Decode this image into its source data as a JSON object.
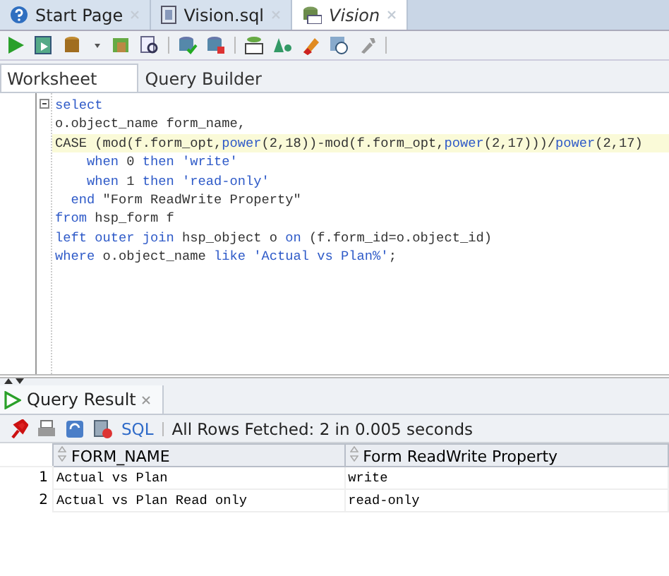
{
  "document_tabs": [
    {
      "label": "Start Page",
      "selected": false
    },
    {
      "label": "Vision.sql",
      "selected": false
    },
    {
      "label": "Vision",
      "selected": true
    }
  ],
  "editor_tabs": [
    {
      "label": "Worksheet",
      "selected": true
    },
    {
      "label": "Query Builder",
      "selected": false
    }
  ],
  "code_lines": [
    {
      "current": false,
      "tokens": [
        {
          "kind": "keyword",
          "text": "select"
        }
      ]
    },
    {
      "current": false,
      "tokens": [
        {
          "kind": "plain",
          "text": "o.object_name form_name,"
        }
      ]
    },
    {
      "current": true,
      "tokens": [
        {
          "kind": "plain",
          "text": "CASE (mod(f.form_opt,"
        },
        {
          "kind": "keyword",
          "text": "power"
        },
        {
          "kind": "plain",
          "text": "(2,18))-mod(f.form_opt,"
        },
        {
          "kind": "keyword",
          "text": "power"
        },
        {
          "kind": "plain",
          "text": "(2,17)))/"
        },
        {
          "kind": "keyword",
          "text": "power"
        },
        {
          "kind": "plain",
          "text": "(2,17)"
        }
      ]
    },
    {
      "current": false,
      "tokens": [
        {
          "kind": "keyword",
          "text": "    when"
        },
        {
          "kind": "plain",
          "text": " 0 "
        },
        {
          "kind": "keyword",
          "text": "then"
        },
        {
          "kind": "string",
          "text": " 'write'"
        }
      ]
    },
    {
      "current": false,
      "tokens": [
        {
          "kind": "keyword",
          "text": "    when"
        },
        {
          "kind": "plain",
          "text": " 1 "
        },
        {
          "kind": "keyword",
          "text": "then"
        },
        {
          "kind": "string",
          "text": " 'read-only'"
        }
      ]
    },
    {
      "current": false,
      "tokens": [
        {
          "kind": "keyword",
          "text": "  end"
        },
        {
          "kind": "plain",
          "text": " \"Form ReadWrite Property\""
        }
      ]
    },
    {
      "current": false,
      "tokens": [
        {
          "kind": "keyword",
          "text": "from"
        },
        {
          "kind": "plain",
          "text": " hsp_form f"
        }
      ]
    },
    {
      "current": false,
      "tokens": [
        {
          "kind": "keyword",
          "text": "left outer join"
        },
        {
          "kind": "plain",
          "text": " hsp_object o "
        },
        {
          "kind": "keyword",
          "text": "on"
        },
        {
          "kind": "plain",
          "text": " (f.form_id=o.object_id)"
        }
      ]
    },
    {
      "current": false,
      "tokens": [
        {
          "kind": "keyword",
          "text": "where"
        },
        {
          "kind": "plain",
          "text": " o.object_name "
        },
        {
          "kind": "keyword",
          "text": "like"
        },
        {
          "kind": "string",
          "text": " 'Actual vs Plan%'"
        },
        {
          "kind": "plain",
          "text": ";"
        }
      ]
    }
  ],
  "result_panel": {
    "tab": {
      "label": "Query Result"
    },
    "sql_link": "SQL",
    "status": "All Rows Fetched: 2 in 0.005 seconds",
    "columns": [
      "FORM_NAME",
      "Form ReadWrite Property"
    ],
    "rows": [
      {
        "number": "1",
        "cells": [
          "Actual vs Plan",
          "write"
        ]
      },
      {
        "number": "2",
        "cells": [
          "Actual vs Plan Read only",
          "read-only"
        ]
      }
    ]
  }
}
